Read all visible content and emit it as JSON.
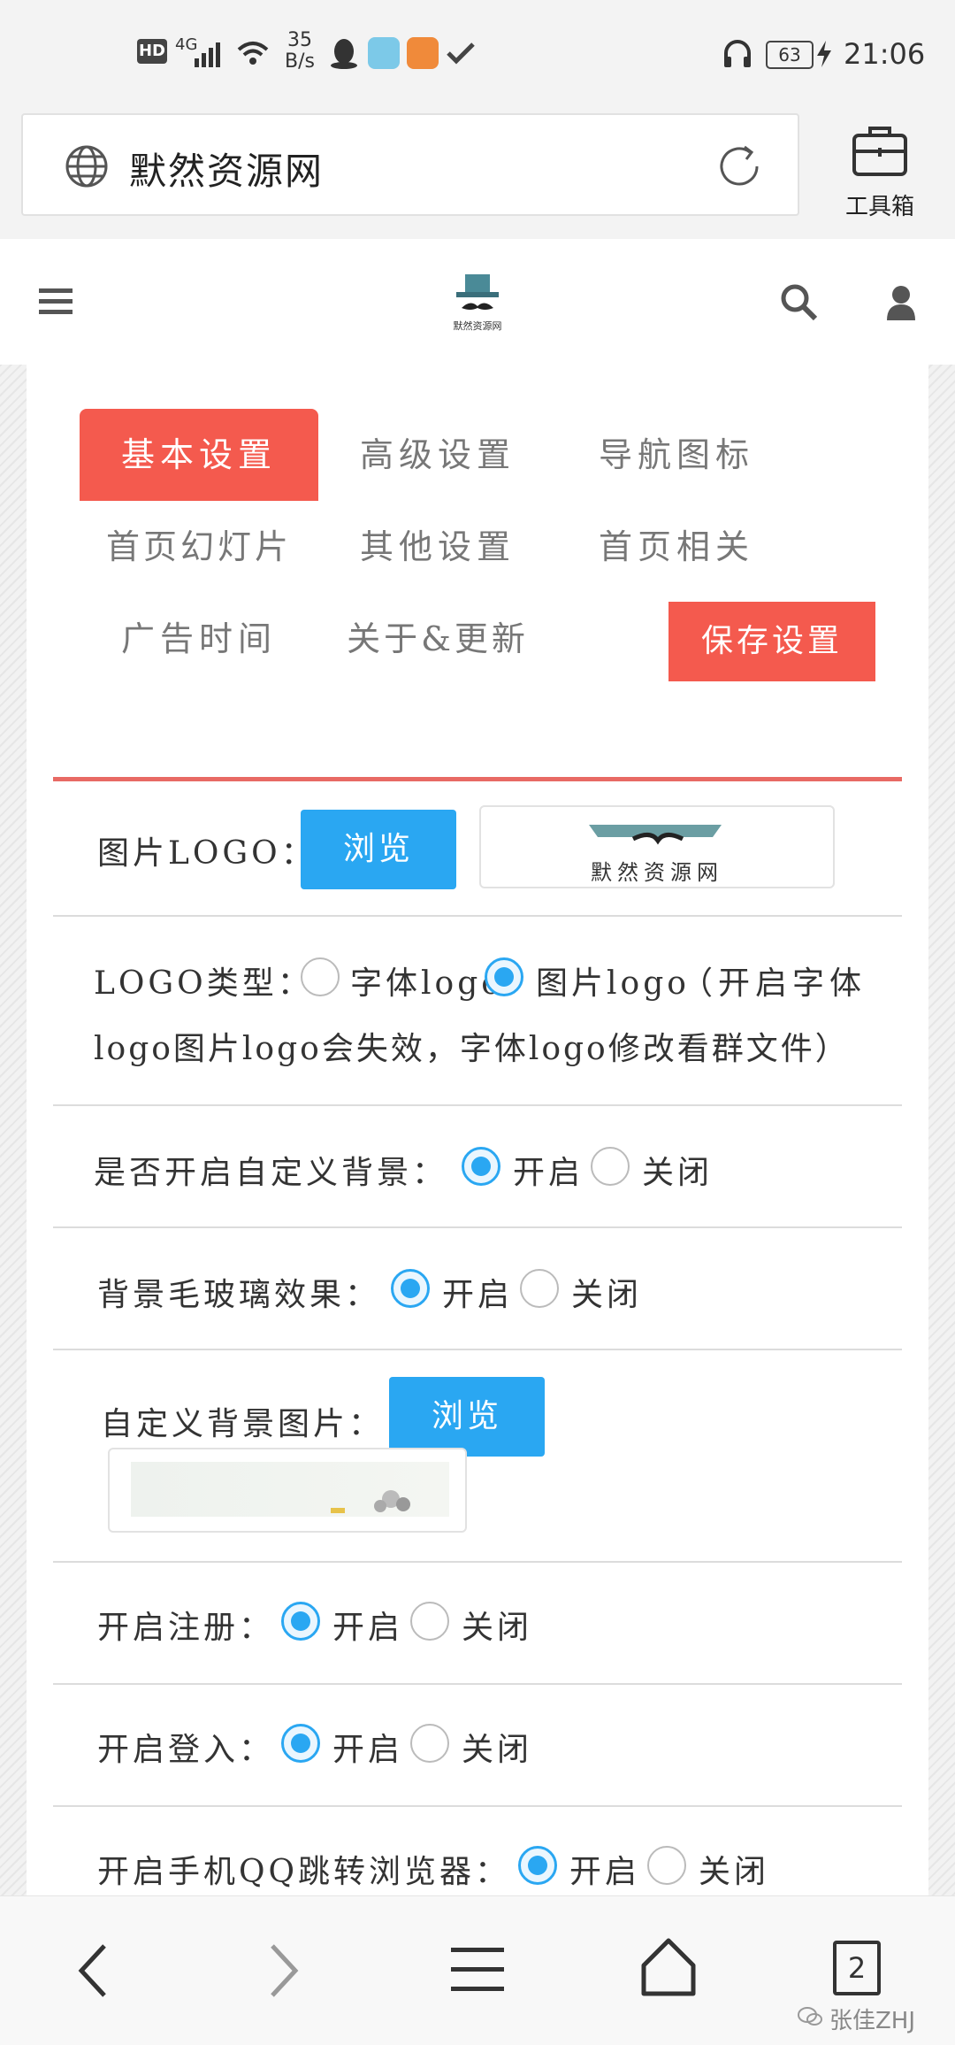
{
  "status_bar": {
    "hd": "HD",
    "network": "4G",
    "speed_value": "35",
    "speed_unit": "B/s",
    "battery": "63",
    "time": "21:06"
  },
  "browser": {
    "url_text": "默然资源网",
    "toolbox_label": "工具箱"
  },
  "site_header": {
    "logo_caption": "默然资源网"
  },
  "tabs": [
    {
      "label": "基本设置",
      "active": true
    },
    {
      "label": "高级设置",
      "active": false
    },
    {
      "label": "导航图标",
      "active": false
    },
    {
      "label": "首页幻灯片",
      "active": false
    },
    {
      "label": "其他设置",
      "active": false
    },
    {
      "label": "首页相关",
      "active": false
    },
    {
      "label": "广告时间",
      "active": false
    },
    {
      "label": "关于&更新",
      "active": false
    }
  ],
  "save_button": "保存设置",
  "settings": {
    "logo_image": {
      "label": "图片LOGO：",
      "browse": "浏览",
      "preview_text": "默然资源网"
    },
    "logo_type": {
      "label": "LOGO类型：",
      "option_font": "字体logo",
      "option_image": "图片logo",
      "note_line1": "（开启字体",
      "note_line2": "logo图片logo会失效，字体logo修改看群文件）",
      "selected": "图片logo"
    },
    "custom_bg": {
      "label": "是否开启自定义背景：",
      "on": "开启",
      "off": "关闭",
      "selected": "开启"
    },
    "frosted_glass": {
      "label": "背景毛玻璃效果：",
      "on": "开启",
      "off": "关闭",
      "selected": "开启"
    },
    "custom_bg_image": {
      "label": "自定义背景图片：",
      "browse": "浏览"
    },
    "registration": {
      "label": "开启注册：",
      "on": "开启",
      "off": "关闭",
      "selected": "开启"
    },
    "login": {
      "label": "开启登入：",
      "on": "开启",
      "off": "关闭",
      "selected": "开启"
    },
    "qq_redirect": {
      "label": "开启手机QQ跳转浏览器：",
      "on": "开启",
      "off": "关闭",
      "selected": "开启"
    }
  },
  "bottom_nav": {
    "tab_count": "2",
    "watermark": "张佳ZHJ"
  },
  "colors": {
    "accent_red": "#f45a4e",
    "accent_blue": "#2aa7f2"
  }
}
